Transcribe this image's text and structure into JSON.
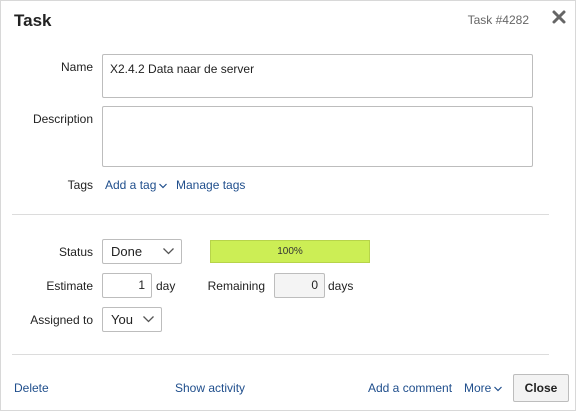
{
  "header": {
    "title": "Task",
    "task_id": "Task #4282"
  },
  "fields": {
    "name_label": "Name",
    "name_value": "X2.4.2 Data naar de server",
    "description_label": "Description",
    "description_value": "",
    "tags_label": "Tags",
    "add_tag": "Add a tag",
    "manage_tags": "Manage tags"
  },
  "status": {
    "label": "Status",
    "value": "Done",
    "progress_text": "100%",
    "progress_fraction": 1.0,
    "progress_color": "#ccee55"
  },
  "estimate": {
    "label": "Estimate",
    "value": "1",
    "unit": "day"
  },
  "remaining": {
    "label": "Remaining",
    "value": "0",
    "unit": "days"
  },
  "assigned": {
    "label": "Assigned to",
    "value": "You"
  },
  "footer": {
    "delete": "Delete",
    "show_activity": "Show activity",
    "add_comment": "Add a comment",
    "more": "More",
    "close": "Close"
  },
  "colors": {
    "link": "#1f4e8c",
    "progress": "#ccee55"
  }
}
